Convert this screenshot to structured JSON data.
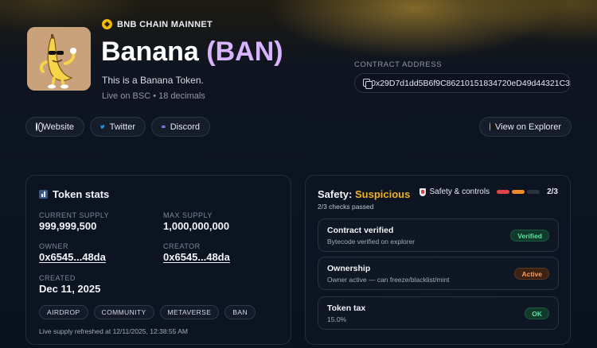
{
  "token": {
    "network": "BNB CHAIN MAINNET",
    "name": "Banana",
    "symbol": "(BAN)",
    "description": "This is a Banana Token.",
    "meta": "Live on BSC • 18 decimals"
  },
  "contract": {
    "label": "CONTRACT ADDRESS",
    "address": "0x29D7d1dd5B6f9C86210151834720eD49d44321C3"
  },
  "links": {
    "website": "Website",
    "twitter": "Twitter",
    "discord": "Discord",
    "explorer": "View on Explorer"
  },
  "stats": {
    "title": "Token stats",
    "current_supply_label": "CURRENT SUPPLY",
    "current_supply": "999,999,500",
    "max_supply_label": "MAX SUPPLY",
    "max_supply": "1,000,000,000",
    "owner_label": "OWNER",
    "owner": "0x6545...48da",
    "creator_label": "CREATOR",
    "creator": "0x6545...48da",
    "created_label": "CREATED",
    "created": "Dec 11, 2025",
    "tags": [
      "AIRDROP",
      "COMMUNITY",
      "METAVERSE",
      "BAN"
    ],
    "refresh": "Live supply refreshed at 12/11/2025, 12:38:55 AM"
  },
  "safety": {
    "title_prefix": "Safety:",
    "verdict": "Suspicious",
    "checks_passed": "2/3 checks passed",
    "controls_label": "Safety & controls",
    "score": "2/3",
    "score_bar_colors": [
      "#e0444b",
      "#f08a2a",
      "#2a3342"
    ],
    "checks": [
      {
        "title": "Contract verified",
        "sub": "Bytecode verified on explorer",
        "badge": "Verified",
        "status": "good"
      },
      {
        "title": "Ownership",
        "sub": "Owner active — can freeze/blacklist/mint",
        "badge": "Active",
        "status": "warn"
      },
      {
        "title": "Token tax",
        "sub": "15.0%",
        "badge": "OK",
        "status": "good"
      }
    ]
  }
}
